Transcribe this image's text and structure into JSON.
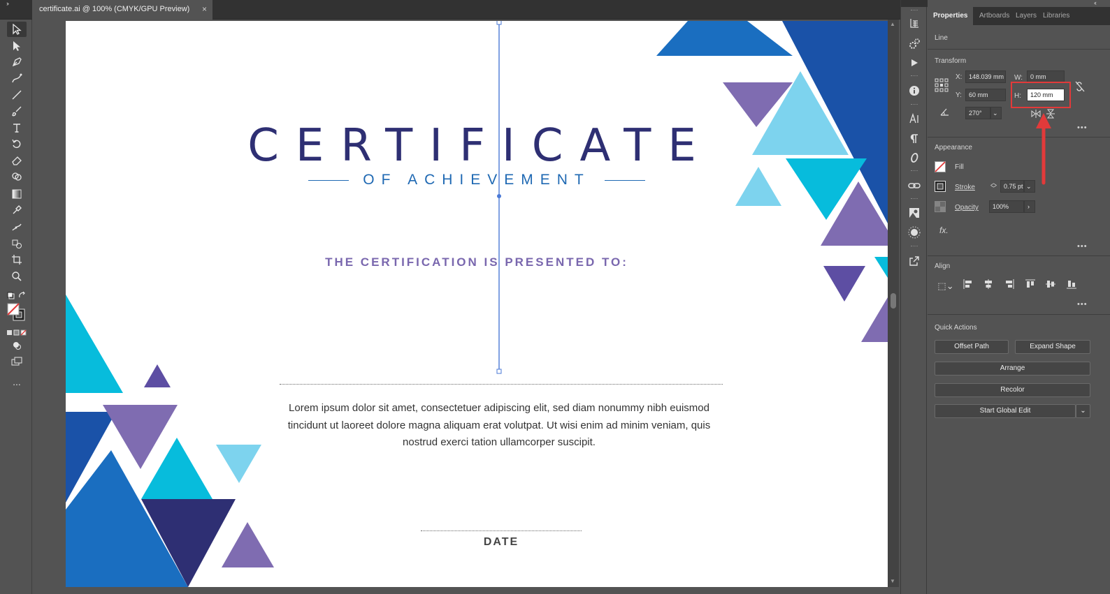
{
  "document": {
    "tab_title": "certificate.ai @ 100% (CMYK/GPU Preview)",
    "close_symbol": "×"
  },
  "toolbar": {
    "tools": [
      {
        "name": "selection-tool",
        "glyph": "▷"
      },
      {
        "name": "direct-selection-tool",
        "glyph": "➤"
      },
      {
        "name": "pen-tool",
        "glyph": "✒"
      },
      {
        "name": "curvature-tool",
        "glyph": "✎"
      },
      {
        "name": "line-segment-tool",
        "glyph": "╱"
      },
      {
        "name": "paintbrush-tool",
        "glyph": "🖌"
      },
      {
        "name": "type-tool",
        "glyph": "T"
      },
      {
        "name": "rotate-tool",
        "glyph": "↺"
      },
      {
        "name": "eraser-tool",
        "glyph": "⌫"
      },
      {
        "name": "shape-builder-tool",
        "glyph": "⊕"
      },
      {
        "name": "gradient-tool",
        "glyph": "▣"
      },
      {
        "name": "eyedropper-tool",
        "glyph": "⚲"
      },
      {
        "name": "puppet-warp-tool",
        "glyph": "✋"
      },
      {
        "name": "live-paint-tool",
        "glyph": "⧉"
      },
      {
        "name": "artboard-tool",
        "glyph": "⬚"
      },
      {
        "name": "zoom-tool",
        "glyph": "⌕"
      }
    ],
    "more": "..."
  },
  "certificate": {
    "title": "CERTIFICATE",
    "subtitle": "OF ACHIEVEMENT",
    "presented_to": "THE CERTIFICATION IS PRESENTED TO:",
    "body": "Lorem ipsum dolor sit amet, consectetuer adipiscing elit, sed diam nonummy nibh euismod tincidunt ut laoreet dolore magna aliquam erat volutpat. Ut wisi enim ad minim veniam, quis nostrud exerci tation ullamcorper suscipit.",
    "date_label": "DATE"
  },
  "panel": {
    "tabs": [
      "Properties",
      "Artboards",
      "Layers",
      "Libraries"
    ],
    "selection_type": "Line",
    "transform": {
      "heading": "Transform",
      "x_label": "X:",
      "x_value": "148.039 mm",
      "y_label": "Y:",
      "y_value": "60 mm",
      "w_label": "W:",
      "w_value": "0 mm",
      "h_label": "H:",
      "h_value": "120 mm",
      "angle_value": "270°"
    },
    "appearance": {
      "heading": "Appearance",
      "fill_label": "Fill",
      "stroke_label": "Stroke",
      "stroke_value": "0.75 pt",
      "opacity_label": "Opacity",
      "opacity_value": "100%",
      "fx_label": "fx."
    },
    "align": {
      "heading": "Align"
    },
    "quick_actions": {
      "heading": "Quick Actions",
      "offset_path": "Offset Path",
      "expand_shape": "Expand Shape",
      "arrange": "Arrange",
      "recolor": "Recolor",
      "start_global_edit": "Start Global Edit"
    },
    "more": "•••"
  },
  "colors": {
    "accent_highlight": "#e23a3a",
    "navy": "#2e2f73",
    "blue": "#1f69b3",
    "purple": "#7967ae",
    "cyan": "#07bcdc",
    "light_cyan": "#7dd3ee",
    "royal": "#1a52a8"
  }
}
